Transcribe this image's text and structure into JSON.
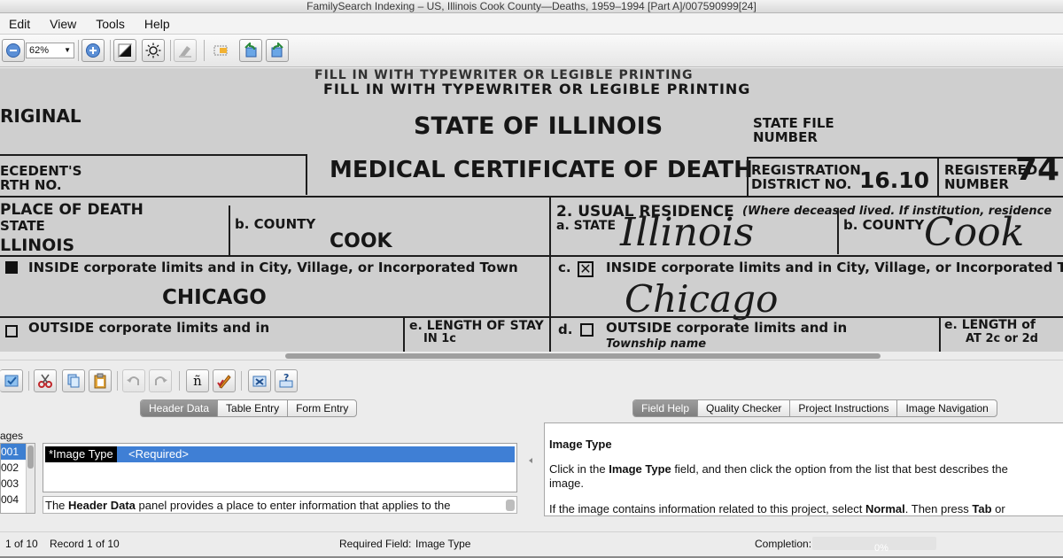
{
  "window": {
    "title": "FamilySearch Indexing – US, Illinois Cook County—Deaths, 1959–1994 [Part A]/007590999[24]"
  },
  "menu": {
    "items": [
      "Edit",
      "View",
      "Tools",
      "Help"
    ]
  },
  "toolbar": {
    "zoom_value": "62%"
  },
  "document": {
    "header_top": "FILL IN WITH TYPEWRITER OR LEGIBLE PRINTING",
    "header_main": "FILL IN WITH TYPEWRITER OR LEGIBLE PRINTING",
    "original": "RIGINAL",
    "state_title": "STATE OF ILLINOIS",
    "cert_title": "MEDICAL CERTIFICATE OF DEATH",
    "state_file": "STATE FILE",
    "number": "NUMBER",
    "decedents": "ECEDENT'S",
    "rth_no": "RTH NO.",
    "registration": "REGISTRATION",
    "district_no": "DISTRICT NO.",
    "district_value": "16.10",
    "registered": "REGISTERED",
    "number2": "NUMBER",
    "reg_value": "74",
    "place_of_death": "PLACE OF DEATH",
    "state_label": "STATE",
    "illinois_typed": "LLINOIS",
    "county_label": "b. COUNTY",
    "cook_typed": "COOK",
    "usual_residence": "2. USUAL RESIDENCE",
    "residence_note": "(Where deceased lived. If institution, residence",
    "a_state": "a. STATE",
    "illinois_hand": "Illinois",
    "b_county": "b. COUNTY",
    "cook_hand": "Cook",
    "inside_left": "INSIDE corporate limits and in City, Village, or Incorporated Town",
    "chicago_typed": "CHICAGO",
    "c_inside": "c.",
    "inside_right": "INSIDE corporate limits and in City, Village, or Incorporated T",
    "chicago_hand": "Chicago",
    "outside_left": "OUTSIDE corporate limits and in",
    "e_length": "e. LENGTH OF STAY",
    "in_1c": "IN 1c",
    "d_outside": "d.",
    "outside_right": "OUTSIDE corporate limits and in",
    "township": "Township name",
    "e_length2": "e. LENGTH of",
    "at_2c": "AT 2c or 2d"
  },
  "entry_panel": {
    "tabs": [
      {
        "label": "Header Data",
        "active": true
      },
      {
        "label": "Table Entry",
        "active": false
      },
      {
        "label": "Form Entry",
        "active": false
      }
    ],
    "images_label": "ages",
    "image_list": [
      "001",
      "002",
      "003",
      "004"
    ],
    "field_label": "*Image Type",
    "field_value": "<Required>",
    "help_text_prefix": "The ",
    "help_text_bold": "Header Data",
    "help_text_suffix": " panel provides a place to enter information that applies to the"
  },
  "help_panel": {
    "tabs": [
      {
        "label": "Field Help",
        "active": true
      },
      {
        "label": "Quality Checker",
        "active": false
      },
      {
        "label": "Project Instructions",
        "active": false
      },
      {
        "label": "Image Navigation",
        "active": false
      }
    ],
    "title": "Image Type",
    "p1_a": "Click in the ",
    "p1_b": "Image Type",
    "p1_c": " field, and then click the option from the list that best describes the",
    "p1_d": "image.",
    "p2_a": "If the image contains information related to this project, select ",
    "p2_b": "Normal",
    "p2_c": ". Then press ",
    "p2_d": "Tab",
    "p2_e": " or"
  },
  "status": {
    "image_count": "1 of 10",
    "record_count": "Record 1 of 10",
    "required_label": "Required Field:",
    "required_value": "Image Type",
    "completion_label": "Completion:",
    "completion_value": "0%"
  }
}
